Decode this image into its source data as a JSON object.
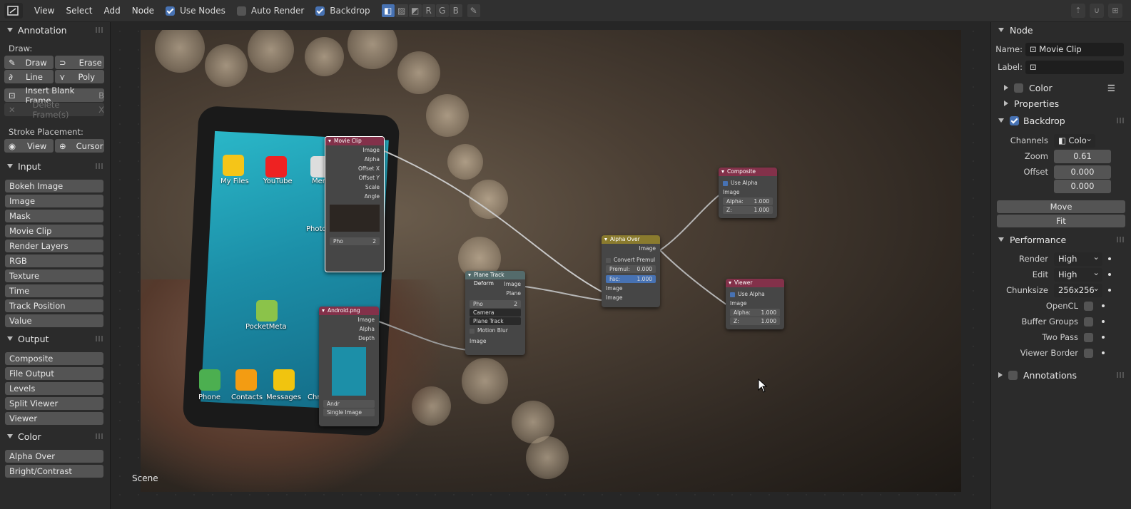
{
  "header": {
    "menus": [
      "View",
      "Select",
      "Add",
      "Node"
    ],
    "use_nodes": {
      "label": "Use Nodes",
      "checked": true
    },
    "auto_render": {
      "label": "Auto Render",
      "checked": false
    },
    "backdrop": {
      "label": "Backdrop",
      "checked": true
    },
    "channel_buttons": [
      "",
      "",
      "",
      "R",
      "G",
      "B",
      ""
    ]
  },
  "left": {
    "annotation": {
      "title": "Annotation",
      "draw_label": "Draw:",
      "draw": "Draw",
      "erase": "Erase",
      "line": "Line",
      "poly": "Poly",
      "insert_blank": "Insert Blank Frame",
      "insert_shortcut": "B",
      "delete_frames": "Delete Frame(s)",
      "delete_shortcut": "X",
      "stroke_placement": "Stroke Placement:",
      "view": "View",
      "cursor": "Cursor"
    },
    "input": {
      "title": "Input",
      "items": [
        "Bokeh Image",
        "Image",
        "Mask",
        "Movie Clip",
        "Render Layers",
        "RGB",
        "Texture",
        "Time",
        "Track Position",
        "Value"
      ]
    },
    "output": {
      "title": "Output",
      "items": [
        "Composite",
        "File Output",
        "Levels",
        "Split Viewer",
        "Viewer"
      ]
    },
    "color": {
      "title": "Color",
      "items": [
        "Alpha Over",
        "Bright/Contrast"
      ]
    }
  },
  "canvas": {
    "scene_label": "Scene",
    "phone_apps": [
      "My Files",
      "YouTube",
      "Memo",
      "Photos",
      "PocketMeta",
      "Phone",
      "Contacts",
      "Messages",
      "Chrome"
    ]
  },
  "nodes": {
    "movie_clip": {
      "title": "Movie Clip",
      "outputs": [
        "Image",
        "Alpha",
        "Offset X",
        "Offset Y",
        "Scale",
        "Angle"
      ],
      "clip": "Pho",
      "users": "2"
    },
    "android": {
      "title": "Android.png",
      "outputs": [
        "Image",
        "Alpha",
        "Depth"
      ],
      "file": "Andr",
      "mode": "Single Image"
    },
    "plane_track": {
      "title": "Plane Track Deform",
      "outputs": [
        "Image",
        "Plane"
      ],
      "clip": "Pho",
      "users": "2",
      "camera": "Camera",
      "track": "Plane Track",
      "motion_blur": "Motion Blur",
      "input": "Image"
    },
    "alpha_over": {
      "title": "Alpha Over",
      "output": "Image",
      "convert": "Convert Premul",
      "premul_label": "Premul:",
      "premul": "0.000",
      "fac_label": "Fac:",
      "fac": "1.000",
      "in1": "Image",
      "in2": "Image"
    },
    "composite": {
      "title": "Composite",
      "use_alpha": "Use Alpha",
      "image": "Image",
      "alpha_label": "Alpha:",
      "alpha": "1.000",
      "z_label": "Z:",
      "z": "1.000"
    },
    "viewer": {
      "title": "Viewer",
      "use_alpha": "Use Alpha",
      "image": "Image",
      "alpha_label": "Alpha:",
      "alpha": "1.000",
      "z_label": "Z:",
      "z": "1.000"
    }
  },
  "right": {
    "node": {
      "title": "Node",
      "name_label": "Name:",
      "name": "Movie Clip",
      "label_label": "Label:",
      "label": "",
      "color": "Color",
      "properties": "Properties"
    },
    "backdrop": {
      "title": "Backdrop",
      "channels_label": "Channels",
      "channels": "Colo",
      "zoom_label": "Zoom",
      "zoom": "0.61",
      "offset_label": "Offset",
      "offset_x": "0.000",
      "offset_y": "0.000",
      "move": "Move",
      "fit": "Fit"
    },
    "performance": {
      "title": "Performance",
      "render_label": "Render",
      "render": "High",
      "edit_label": "Edit",
      "edit": "High",
      "chunksize_label": "Chunksize",
      "chunksize": "256x256",
      "opencl": "OpenCL",
      "buffer_groups": "Buffer Groups",
      "two_pass": "Two Pass",
      "viewer_border": "Viewer Border"
    },
    "annotations": {
      "title": "Annotations"
    }
  },
  "colors": {
    "accent": "#4772b3",
    "socket": "#c7c729",
    "node_red": "#83314a",
    "node_yellow": "#8a7b2e"
  }
}
